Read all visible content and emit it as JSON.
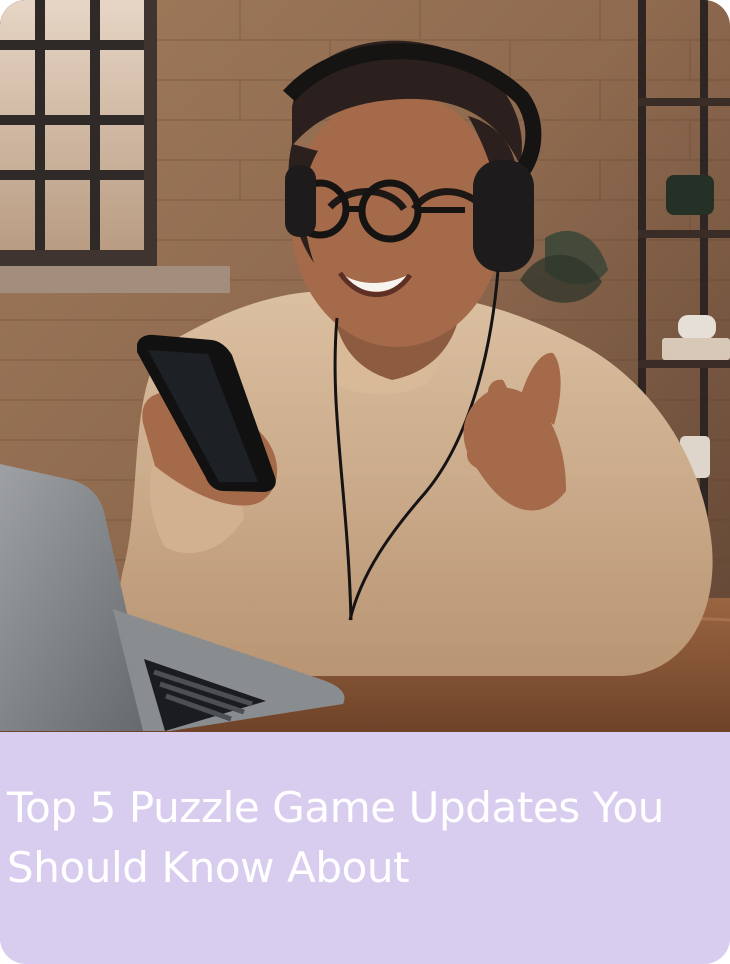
{
  "card": {
    "title": "Top 5 Puzzle Game Updates You Should Know About",
    "image_alt": "Smiling person with headphones and glasses holding a phone near a laptop",
    "caption_background": "#d9cdef",
    "title_color": "#ffffff"
  }
}
